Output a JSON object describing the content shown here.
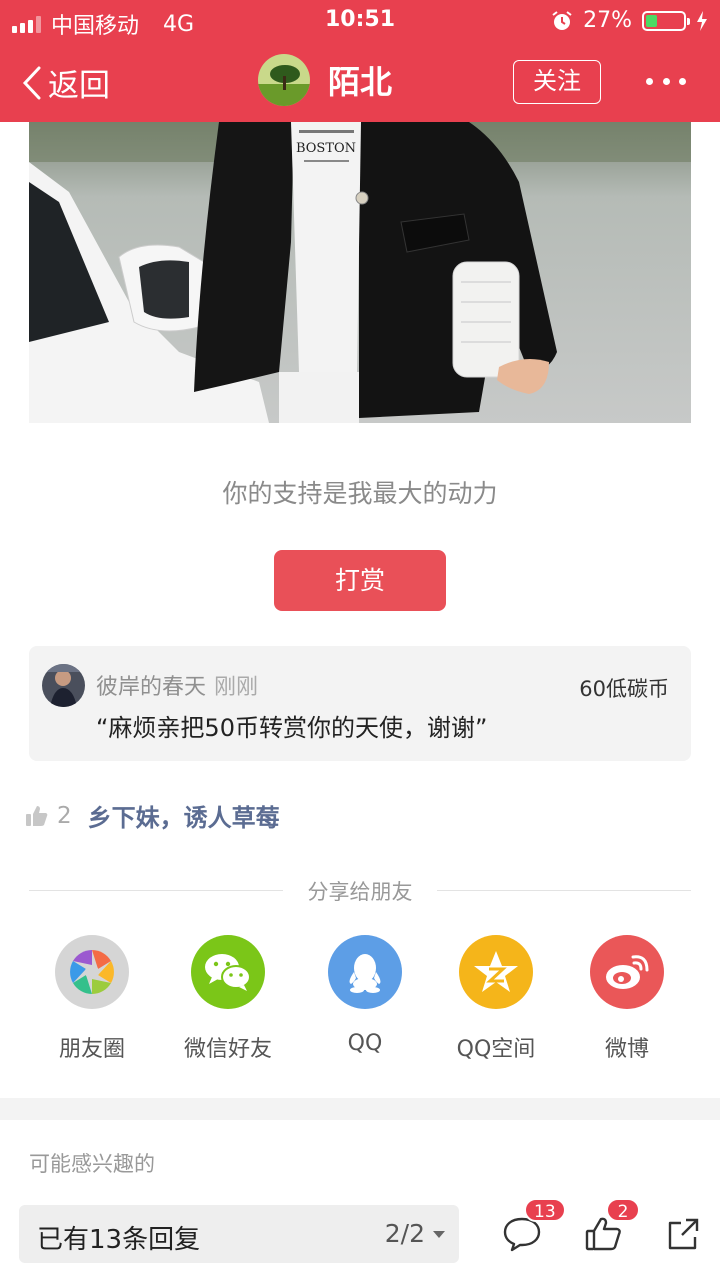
{
  "status_bar": {
    "carrier": "中国移动",
    "network": "4G",
    "time": "10:51",
    "battery": "27%",
    "icons": [
      "signal-icon",
      "alarm-icon",
      "battery-icon",
      "charging-icon"
    ]
  },
  "nav": {
    "back_label": "返回",
    "author_name": "陌北",
    "follow_label": "关注"
  },
  "post": {
    "support_text": "你的支持是我最大的动力",
    "reward_label": "打赏",
    "photo_shirt_text": "BOSTON"
  },
  "tip": {
    "user": "彼岸的春天",
    "time": "刚刚",
    "amount": "60低碳币",
    "message": "“麻烦亲把50币转赏你的天使，谢谢”"
  },
  "likes": {
    "count": "2",
    "names": "乡下妹，诱人草莓"
  },
  "share": {
    "title": "分享给朋友",
    "items": [
      {
        "label": "朋友圈",
        "icon": "moments-icon",
        "color": "#d7d7d7"
      },
      {
        "label": "微信好友",
        "icon": "wechat-icon",
        "color": "#7bc618"
      },
      {
        "label": "QQ",
        "icon": "qq-icon",
        "color": "#5d9ee6"
      },
      {
        "label": "QQ空间",
        "icon": "qzone-icon",
        "color": "#f5b51a"
      },
      {
        "label": "微博",
        "icon": "weibo-icon",
        "color": "#ea5758"
      }
    ]
  },
  "related": {
    "title": "可能感兴趣的"
  },
  "bottom_bar": {
    "reply_text": "已有13条回复",
    "page": "2/2",
    "comment_count": "13",
    "like_count": "2"
  },
  "colors": {
    "brand": "#e8404f",
    "reward_button": "#e95058",
    "link_names": "#5b6c92"
  }
}
